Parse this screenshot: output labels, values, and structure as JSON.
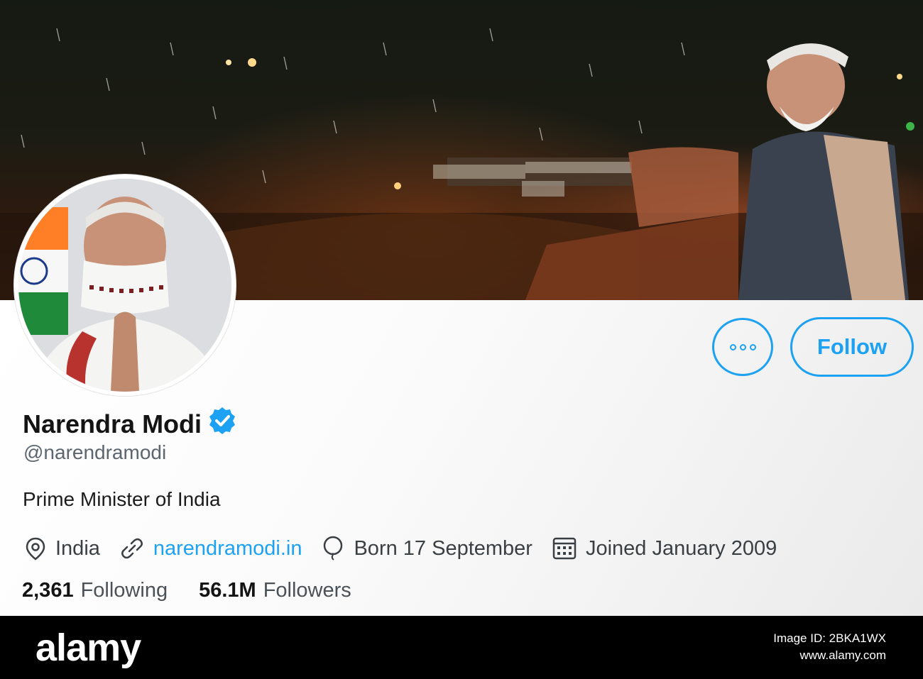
{
  "profile": {
    "display_name": "Narendra Modi",
    "handle": "@narendramodi",
    "bio": "Prime Minister of India",
    "verified": true,
    "location": "India",
    "website": "narendramodi.in",
    "birthday": "Born 17 September",
    "joined": "Joined January 2009"
  },
  "actions": {
    "more_icon": "more-horizontal-icon",
    "follow_label": "Follow"
  },
  "stats": {
    "following_count": "2,361",
    "following_label": "Following",
    "followers_count": "56.1M",
    "followers_label": "Followers"
  },
  "icons": {
    "location": "location-pin-icon",
    "website": "link-icon",
    "birthday": "balloon-icon",
    "joined": "calendar-icon",
    "verified": "verified-badge-icon"
  },
  "colors": {
    "accent": "#1da1f2",
    "text": "#141414",
    "secondary_text": "#5b6670"
  },
  "watermark": {
    "logo": "alamy",
    "image_id": "Image ID: 2BKA1WX",
    "site": "www.alamy.com"
  }
}
